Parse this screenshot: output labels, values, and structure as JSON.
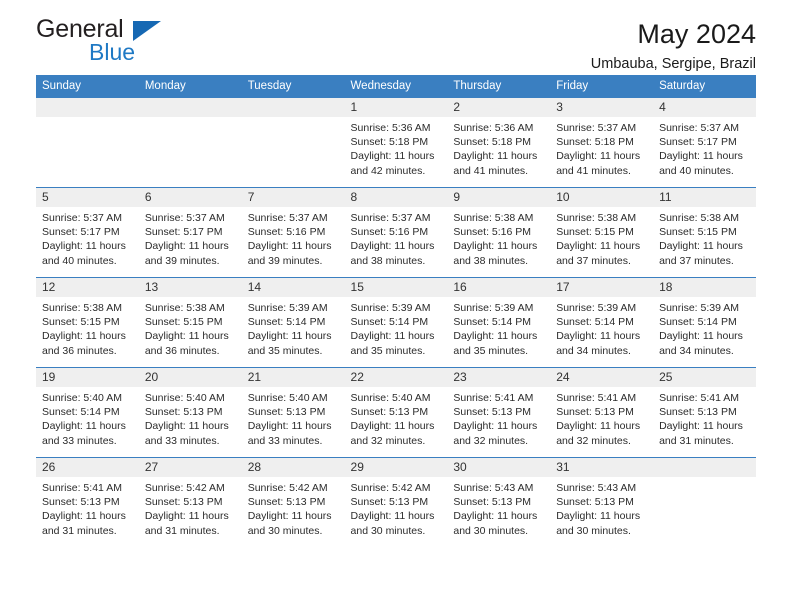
{
  "brand": {
    "name_part1": "General",
    "name_part2": "Blue",
    "accent_color": "#1668b3",
    "dark_color": "#231f20"
  },
  "header": {
    "title": "May 2024",
    "subtitle": "Umbauba, Sergipe, Brazil"
  },
  "theme": {
    "header_row_bg": "#3a7fc1",
    "daynum_bg": "#efefef",
    "row_border": "#3a7fc1"
  },
  "weekday_headers": [
    "Sunday",
    "Monday",
    "Tuesday",
    "Wednesday",
    "Thursday",
    "Friday",
    "Saturday"
  ],
  "labels": {
    "sunrise_prefix": "Sunrise:",
    "sunset_prefix": "Sunset:",
    "daylight_prefix": "Daylight:"
  },
  "weeks": [
    [
      {
        "day": "",
        "blank": true,
        "sunrise": "",
        "sunset": "",
        "daylight_line1": "",
        "daylight_line2": ""
      },
      {
        "day": "",
        "blank": true,
        "sunrise": "",
        "sunset": "",
        "daylight_line1": "",
        "daylight_line2": ""
      },
      {
        "day": "",
        "blank": true,
        "sunrise": "",
        "sunset": "",
        "daylight_line1": "",
        "daylight_line2": ""
      },
      {
        "day": "1",
        "blank": false,
        "sunrise": "Sunrise: 5:36 AM",
        "sunset": "Sunset: 5:18 PM",
        "daylight_line1": "Daylight: 11 hours",
        "daylight_line2": "and 42 minutes."
      },
      {
        "day": "2",
        "blank": false,
        "sunrise": "Sunrise: 5:36 AM",
        "sunset": "Sunset: 5:18 PM",
        "daylight_line1": "Daylight: 11 hours",
        "daylight_line2": "and 41 minutes."
      },
      {
        "day": "3",
        "blank": false,
        "sunrise": "Sunrise: 5:37 AM",
        "sunset": "Sunset: 5:18 PM",
        "daylight_line1": "Daylight: 11 hours",
        "daylight_line2": "and 41 minutes."
      },
      {
        "day": "4",
        "blank": false,
        "sunrise": "Sunrise: 5:37 AM",
        "sunset": "Sunset: 5:17 PM",
        "daylight_line1": "Daylight: 11 hours",
        "daylight_line2": "and 40 minutes."
      }
    ],
    [
      {
        "day": "5",
        "blank": false,
        "sunrise": "Sunrise: 5:37 AM",
        "sunset": "Sunset: 5:17 PM",
        "daylight_line1": "Daylight: 11 hours",
        "daylight_line2": "and 40 minutes."
      },
      {
        "day": "6",
        "blank": false,
        "sunrise": "Sunrise: 5:37 AM",
        "sunset": "Sunset: 5:17 PM",
        "daylight_line1": "Daylight: 11 hours",
        "daylight_line2": "and 39 minutes."
      },
      {
        "day": "7",
        "blank": false,
        "sunrise": "Sunrise: 5:37 AM",
        "sunset": "Sunset: 5:16 PM",
        "daylight_line1": "Daylight: 11 hours",
        "daylight_line2": "and 39 minutes."
      },
      {
        "day": "8",
        "blank": false,
        "sunrise": "Sunrise: 5:37 AM",
        "sunset": "Sunset: 5:16 PM",
        "daylight_line1": "Daylight: 11 hours",
        "daylight_line2": "and 38 minutes."
      },
      {
        "day": "9",
        "blank": false,
        "sunrise": "Sunrise: 5:38 AM",
        "sunset": "Sunset: 5:16 PM",
        "daylight_line1": "Daylight: 11 hours",
        "daylight_line2": "and 38 minutes."
      },
      {
        "day": "10",
        "blank": false,
        "sunrise": "Sunrise: 5:38 AM",
        "sunset": "Sunset: 5:15 PM",
        "daylight_line1": "Daylight: 11 hours",
        "daylight_line2": "and 37 minutes."
      },
      {
        "day": "11",
        "blank": false,
        "sunrise": "Sunrise: 5:38 AM",
        "sunset": "Sunset: 5:15 PM",
        "daylight_line1": "Daylight: 11 hours",
        "daylight_line2": "and 37 minutes."
      }
    ],
    [
      {
        "day": "12",
        "blank": false,
        "sunrise": "Sunrise: 5:38 AM",
        "sunset": "Sunset: 5:15 PM",
        "daylight_line1": "Daylight: 11 hours",
        "daylight_line2": "and 36 minutes."
      },
      {
        "day": "13",
        "blank": false,
        "sunrise": "Sunrise: 5:38 AM",
        "sunset": "Sunset: 5:15 PM",
        "daylight_line1": "Daylight: 11 hours",
        "daylight_line2": "and 36 minutes."
      },
      {
        "day": "14",
        "blank": false,
        "sunrise": "Sunrise: 5:39 AM",
        "sunset": "Sunset: 5:14 PM",
        "daylight_line1": "Daylight: 11 hours",
        "daylight_line2": "and 35 minutes."
      },
      {
        "day": "15",
        "blank": false,
        "sunrise": "Sunrise: 5:39 AM",
        "sunset": "Sunset: 5:14 PM",
        "daylight_line1": "Daylight: 11 hours",
        "daylight_line2": "and 35 minutes."
      },
      {
        "day": "16",
        "blank": false,
        "sunrise": "Sunrise: 5:39 AM",
        "sunset": "Sunset: 5:14 PM",
        "daylight_line1": "Daylight: 11 hours",
        "daylight_line2": "and 35 minutes."
      },
      {
        "day": "17",
        "blank": false,
        "sunrise": "Sunrise: 5:39 AM",
        "sunset": "Sunset: 5:14 PM",
        "daylight_line1": "Daylight: 11 hours",
        "daylight_line2": "and 34 minutes."
      },
      {
        "day": "18",
        "blank": false,
        "sunrise": "Sunrise: 5:39 AM",
        "sunset": "Sunset: 5:14 PM",
        "daylight_line1": "Daylight: 11 hours",
        "daylight_line2": "and 34 minutes."
      }
    ],
    [
      {
        "day": "19",
        "blank": false,
        "sunrise": "Sunrise: 5:40 AM",
        "sunset": "Sunset: 5:14 PM",
        "daylight_line1": "Daylight: 11 hours",
        "daylight_line2": "and 33 minutes."
      },
      {
        "day": "20",
        "blank": false,
        "sunrise": "Sunrise: 5:40 AM",
        "sunset": "Sunset: 5:13 PM",
        "daylight_line1": "Daylight: 11 hours",
        "daylight_line2": "and 33 minutes."
      },
      {
        "day": "21",
        "blank": false,
        "sunrise": "Sunrise: 5:40 AM",
        "sunset": "Sunset: 5:13 PM",
        "daylight_line1": "Daylight: 11 hours",
        "daylight_line2": "and 33 minutes."
      },
      {
        "day": "22",
        "blank": false,
        "sunrise": "Sunrise: 5:40 AM",
        "sunset": "Sunset: 5:13 PM",
        "daylight_line1": "Daylight: 11 hours",
        "daylight_line2": "and 32 minutes."
      },
      {
        "day": "23",
        "blank": false,
        "sunrise": "Sunrise: 5:41 AM",
        "sunset": "Sunset: 5:13 PM",
        "daylight_line1": "Daylight: 11 hours",
        "daylight_line2": "and 32 minutes."
      },
      {
        "day": "24",
        "blank": false,
        "sunrise": "Sunrise: 5:41 AM",
        "sunset": "Sunset: 5:13 PM",
        "daylight_line1": "Daylight: 11 hours",
        "daylight_line2": "and 32 minutes."
      },
      {
        "day": "25",
        "blank": false,
        "sunrise": "Sunrise: 5:41 AM",
        "sunset": "Sunset: 5:13 PM",
        "daylight_line1": "Daylight: 11 hours",
        "daylight_line2": "and 31 minutes."
      }
    ],
    [
      {
        "day": "26",
        "blank": false,
        "sunrise": "Sunrise: 5:41 AM",
        "sunset": "Sunset: 5:13 PM",
        "daylight_line1": "Daylight: 11 hours",
        "daylight_line2": "and 31 minutes."
      },
      {
        "day": "27",
        "blank": false,
        "sunrise": "Sunrise: 5:42 AM",
        "sunset": "Sunset: 5:13 PM",
        "daylight_line1": "Daylight: 11 hours",
        "daylight_line2": "and 31 minutes."
      },
      {
        "day": "28",
        "blank": false,
        "sunrise": "Sunrise: 5:42 AM",
        "sunset": "Sunset: 5:13 PM",
        "daylight_line1": "Daylight: 11 hours",
        "daylight_line2": "and 30 minutes."
      },
      {
        "day": "29",
        "blank": false,
        "sunrise": "Sunrise: 5:42 AM",
        "sunset": "Sunset: 5:13 PM",
        "daylight_line1": "Daylight: 11 hours",
        "daylight_line2": "and 30 minutes."
      },
      {
        "day": "30",
        "blank": false,
        "sunrise": "Sunrise: 5:43 AM",
        "sunset": "Sunset: 5:13 PM",
        "daylight_line1": "Daylight: 11 hours",
        "daylight_line2": "and 30 minutes."
      },
      {
        "day": "31",
        "blank": false,
        "sunrise": "Sunrise: 5:43 AM",
        "sunset": "Sunset: 5:13 PM",
        "daylight_line1": "Daylight: 11 hours",
        "daylight_line2": "and 30 minutes."
      },
      {
        "day": "",
        "blank": true,
        "sunrise": "",
        "sunset": "",
        "daylight_line1": "",
        "daylight_line2": ""
      }
    ]
  ]
}
